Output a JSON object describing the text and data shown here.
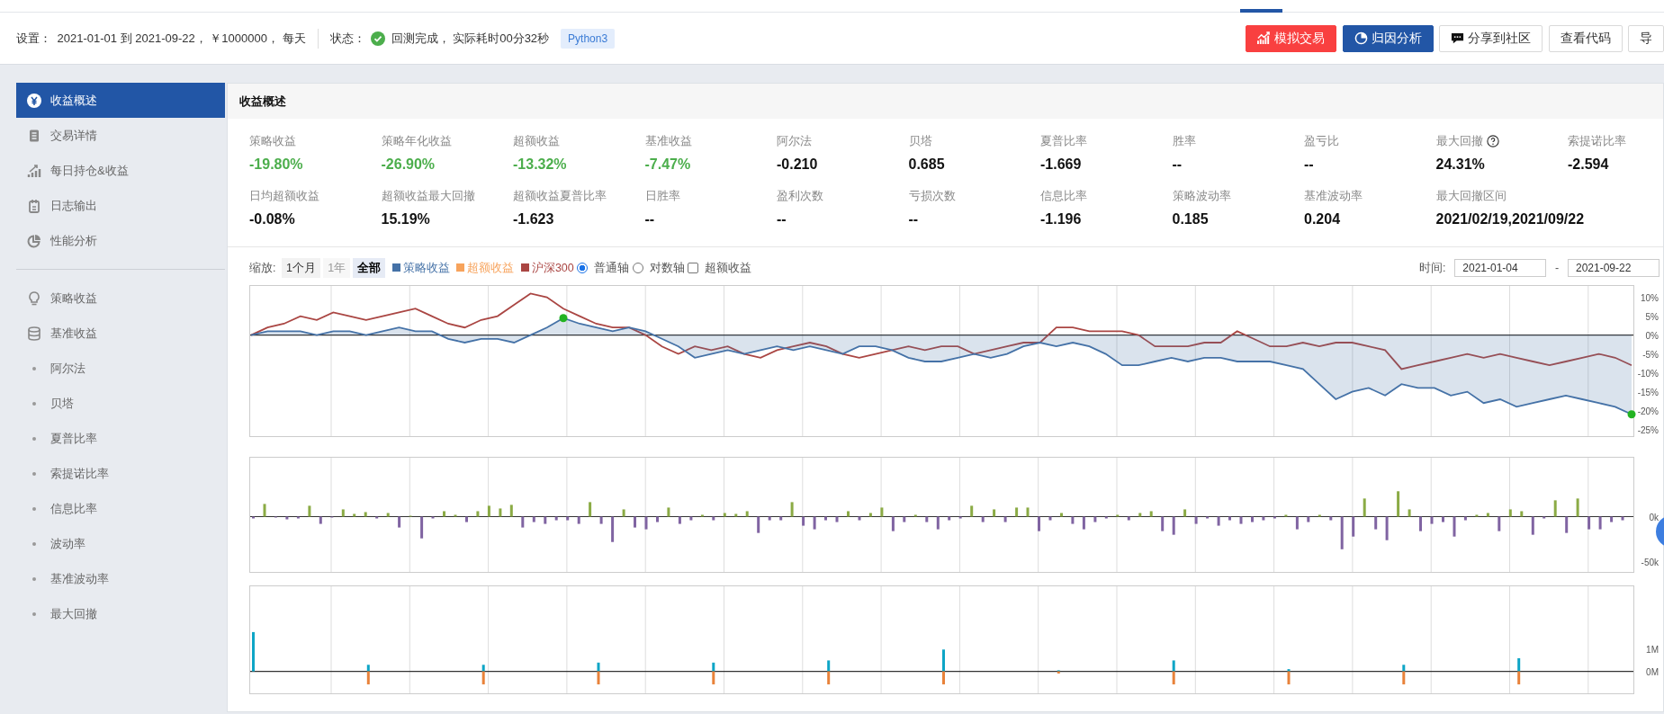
{
  "settings": {
    "label": "设置：",
    "value": "2021-01-01 到 2021-09-22， ￥1000000， 每天"
  },
  "status": {
    "label": "状态：",
    "value": "回测完成， 实际耗时00分32秒",
    "done": true,
    "badge": "Python3"
  },
  "actions": [
    {
      "label": "模拟交易",
      "kind": "danger"
    },
    {
      "label": "归因分析",
      "kind": "primary"
    },
    {
      "label": "分享到社区",
      "kind": "plain"
    },
    {
      "label": "查看代码",
      "kind": "plain"
    },
    {
      "label": "导",
      "kind": "plain"
    }
  ],
  "sidebar": {
    "groups": [
      {
        "items": [
          {
            "label": "收益概述",
            "kind": "icon",
            "selected": true
          },
          {
            "label": "交易详情",
            "kind": "icon",
            "selected": false
          },
          {
            "label": "每日持仓&收益",
            "kind": "icon",
            "selected": false
          },
          {
            "label": "日志输出",
            "kind": "icon",
            "selected": false
          },
          {
            "label": "性能分析",
            "kind": "icon",
            "selected": false
          }
        ]
      },
      {
        "items": [
          {
            "label": "策略收益",
            "kind": "icon",
            "selected": false
          },
          {
            "label": "基准收益",
            "kind": "icon",
            "selected": false
          },
          {
            "label": "阿尔法",
            "kind": "bullet",
            "selected": false
          },
          {
            "label": "贝塔",
            "kind": "bullet",
            "selected": false
          },
          {
            "label": "夏普比率",
            "kind": "bullet",
            "selected": false
          },
          {
            "label": "索提诺比率",
            "kind": "bullet",
            "selected": false
          },
          {
            "label": "信息比率",
            "kind": "bullet",
            "selected": false
          },
          {
            "label": "波动率",
            "kind": "bullet",
            "selected": false
          },
          {
            "label": "基准波动率",
            "kind": "bullet",
            "selected": false
          },
          {
            "label": "最大回撤",
            "kind": "bullet",
            "selected": false
          }
        ]
      }
    ]
  },
  "panel": {
    "title": "收益概述",
    "metrics": [
      {
        "label": "策略收益",
        "value": "-19.80%",
        "color": "#4cae4c",
        "help": false
      },
      {
        "label": "策略年化收益",
        "value": "-26.90%",
        "color": "#4cae4c",
        "help": false
      },
      {
        "label": "超额收益",
        "value": "-13.32%",
        "color": "#4cae4c",
        "help": false
      },
      {
        "label": "基准收益",
        "value": "-7.47%",
        "color": "#4cae4c",
        "help": false
      },
      {
        "label": "阿尔法",
        "value": "-0.210",
        "color": "#111111",
        "help": false
      },
      {
        "label": "贝塔",
        "value": "0.685",
        "color": "#111111",
        "help": false
      },
      {
        "label": "夏普比率",
        "value": "-1.669",
        "color": "#111111",
        "help": false
      },
      {
        "label": "胜率",
        "value": "--",
        "color": "#111111",
        "help": false
      },
      {
        "label": "盈亏比",
        "value": "--",
        "color": "#111111",
        "help": false
      },
      {
        "label": "最大回撤",
        "value": "24.31%",
        "color": "#111111",
        "help": true
      },
      {
        "label": "索提诺比率",
        "value": "-2.594",
        "color": "#111111",
        "help": false
      },
      {
        "label": "日均超额收益",
        "value": "-0.08%",
        "color": "#111111",
        "help": false
      },
      {
        "label": "超额收益最大回撤",
        "value": "15.19%",
        "color": "#111111",
        "help": false
      },
      {
        "label": "超额收益夏普比率",
        "value": "-1.623",
        "color": "#111111",
        "help": false
      },
      {
        "label": "日胜率",
        "value": "--",
        "color": "#111111",
        "help": false
      },
      {
        "label": "盈利次数",
        "value": "--",
        "color": "#111111",
        "help": false
      },
      {
        "label": "亏损次数",
        "value": "--",
        "color": "#111111",
        "help": false
      },
      {
        "label": "信息比率",
        "value": "-1.196",
        "color": "#111111",
        "help": false
      },
      {
        "label": "策略波动率",
        "value": "0.185",
        "color": "#111111",
        "help": false
      },
      {
        "label": "基准波动率",
        "value": "0.204",
        "color": "#111111",
        "help": false
      },
      {
        "label": "最大回撤区间",
        "value": "2021/02/19,2021/09/22",
        "color": "#111111",
        "help": false
      }
    ],
    "zoom": {
      "label": "缩放:",
      "options": [
        {
          "label": "1个月",
          "selected": false,
          "disabled": false
        },
        {
          "label": "1年",
          "selected": false,
          "disabled": true
        },
        {
          "label": "全部",
          "selected": true,
          "disabled": false
        }
      ]
    },
    "legend": [
      {
        "label": "策略收益",
        "color": "#4572a7"
      },
      {
        "label": "超额收益",
        "color": "#f7a35c"
      },
      {
        "label": "沪深300",
        "color": "#aa4643"
      }
    ],
    "axis_options": [
      {
        "label": "普通轴",
        "kind": "radio",
        "checked": true
      },
      {
        "label": "对数轴",
        "kind": "radio",
        "checked": false
      },
      {
        "label": "超额收益",
        "kind": "checkbox",
        "checked": false
      }
    ],
    "time": {
      "label": "时间:",
      "from": "2021-01-04",
      "separator": "-",
      "to": "2021-09-22"
    },
    "returns_chart": {
      "chart_data": {
        "type": "line",
        "grid": true,
        "ylim": [
          -27,
          13
        ],
        "yticks": [
          {
            "value": 10,
            "label": "10%"
          },
          {
            "value": 5,
            "label": "5%"
          },
          {
            "value": 0,
            "label": "0%"
          },
          {
            "value": -5,
            "label": "-5%"
          },
          {
            "value": -10,
            "label": "-10%"
          },
          {
            "value": -15,
            "label": "-15%"
          },
          {
            "value": -20,
            "label": "-20%"
          },
          {
            "value": -25,
            "label": "-25%"
          }
        ],
        "series": [
          {
            "color": "#4572a7",
            "values": [
              0,
              1,
              1,
              1,
              0,
              1,
              1,
              0,
              1,
              2,
              1,
              1,
              -1,
              -2,
              -1,
              -1,
              -2,
              0,
              2,
              4.5,
              3,
              2,
              1,
              2,
              1,
              -1,
              -3,
              -6,
              -5,
              -4,
              -5,
              -4,
              -3,
              -4,
              -3,
              -4,
              -5,
              -3,
              -3,
              -4,
              -6,
              -7,
              -7,
              -6,
              -5,
              -6,
              -5,
              -3,
              -2,
              -3,
              -2,
              -3,
              -5,
              -8,
              -8,
              -7,
              -6,
              -7,
              -6,
              -6,
              -7,
              -7,
              -7,
              -8,
              -9,
              -13,
              -17,
              -15,
              -14,
              -16,
              -13,
              -14,
              -14,
              -16,
              -15,
              -18,
              -17,
              -19,
              -18,
              -17,
              -16,
              -17,
              -18,
              -19,
              -21
            ]
          },
          {
            "color": "#aa4643",
            "values": [
              0,
              2,
              3,
              5,
              4,
              6,
              5,
              4,
              5,
              6,
              7,
              5,
              3,
              2,
              4,
              5,
              8,
              11,
              10,
              7,
              5,
              3,
              2,
              2,
              0,
              -3,
              -5,
              -3,
              -4,
              -3,
              -5,
              -6,
              -4,
              -3,
              -2,
              -3,
              -5,
              -6,
              -5,
              -4,
              -3,
              -4,
              -3,
              -3,
              -5,
              -4,
              -3,
              -2,
              -2,
              2,
              2,
              1,
              1,
              1,
              0,
              -3,
              -3,
              -3,
              -2,
              -2,
              1,
              -1,
              -3,
              -3,
              -2,
              -3,
              -2,
              -2,
              -3,
              -4,
              -9,
              -8,
              -7,
              -6,
              -5,
              -6,
              -5,
              -6,
              -7,
              -8,
              -7,
              -6,
              -5,
              -6,
              -8
            ]
          }
        ]
      }
    },
    "pnl_chart": {
      "chart_data": {
        "type": "bar",
        "ylim": [
          -62,
          65
        ],
        "yticks": [
          {
            "value": 0,
            "label": "0k"
          },
          {
            "value": -50,
            "label": "-50k"
          }
        ],
        "grid": true,
        "stacked": true,
        "series": [
          {
            "color": "#8bab45",
            "values": [
              null,
              14,
              null,
              null,
              null,
              12,
              null,
              null,
              8,
              3,
              5,
              null,
              4,
              null,
              1,
              null,
              null,
              6,
              2,
              null,
              6,
              12,
              9,
              13,
              null,
              null,
              null,
              null,
              null,
              null,
              16,
              null,
              null,
              8,
              null,
              null,
              null,
              10,
              null,
              null,
              2,
              null,
              4,
              3,
              6,
              null,
              null,
              null,
              16,
              null,
              null,
              null,
              null,
              6,
              null,
              4,
              10,
              null,
              null,
              2,
              null,
              null,
              null,
              null,
              12,
              null,
              8,
              null,
              10,
              10,
              null,
              null,
              4,
              null,
              null,
              null,
              null,
              2,
              null,
              4,
              6,
              null,
              null,
              8,
              null,
              null,
              null,
              null,
              null,
              null,
              null,
              null,
              2,
              null,
              null,
              2,
              null,
              null,
              null,
              20,
              null,
              null,
              28,
              8,
              null,
              null,
              null,
              null,
              null,
              2,
              4,
              null,
              8,
              6,
              null,
              null,
              18,
              null,
              20,
              null,
              null,
              null,
              null
            ]
          },
          {
            "color": "#8064a2",
            "values": [
              -2,
              null,
              -1,
              -3,
              -2,
              null,
              -8,
              -1,
              null,
              null,
              null,
              -2,
              null,
              -12,
              null,
              -24,
              -2,
              null,
              null,
              -6,
              null,
              null,
              null,
              null,
              -12,
              -6,
              -8,
              -4,
              -4,
              -8,
              null,
              -8,
              -28,
              null,
              -12,
              -14,
              -6,
              null,
              -8,
              -4,
              null,
              -4,
              null,
              null,
              null,
              -18,
              -4,
              -4,
              null,
              -10,
              -14,
              -4,
              -6,
              null,
              -4,
              null,
              null,
              -16,
              -6,
              null,
              -6,
              -14,
              -4,
              -2,
              null,
              -6,
              null,
              -6,
              null,
              null,
              -16,
              -4,
              null,
              -8,
              -14,
              -6,
              -2,
              null,
              -4,
              null,
              null,
              -16,
              -20,
              null,
              -8,
              -2,
              -10,
              -4,
              -8,
              -6,
              -4,
              -2,
              null,
              -14,
              -6,
              null,
              -4,
              -36,
              -22,
              null,
              -14,
              -26,
              null,
              null,
              -16,
              -8,
              -6,
              -22,
              -4,
              null,
              null,
              -16,
              null,
              null,
              -20,
              -2,
              null,
              -18,
              null,
              -14,
              -14,
              -6,
              -4
            ]
          }
        ]
      }
    },
    "volume_chart": {
      "chart_data": {
        "type": "bar",
        "grid": true,
        "stacked": true,
        "ylim": [
          -1.05,
          3.9
        ],
        "categories": [
          null,
          null,
          null,
          null,
          null,
          null,
          null,
          null,
          null,
          null,
          null,
          null
        ],
        "yticks": [
          {
            "value": 1,
            "label": "1M"
          },
          {
            "value": 0,
            "label": "0M"
          }
        ],
        "series": [
          {
            "color": "#0ea5c6",
            "values": [
              1.8,
              0.3,
              0.3,
              0.4,
              0.4,
              0.5,
              1.0,
              0.05,
              0.5,
              0.1,
              0.3,
              0.6
            ]
          },
          {
            "color": "#e8823a",
            "values": [
              null,
              -0.6,
              -0.6,
              -0.6,
              -0.6,
              -0.6,
              -0.6,
              -0.1,
              -0.6,
              -0.6,
              -0.6,
              -0.6
            ]
          }
        ]
      }
    }
  }
}
